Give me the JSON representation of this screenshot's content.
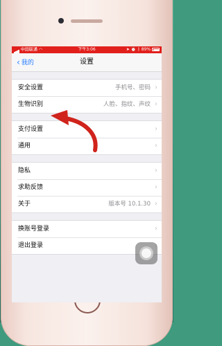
{
  "statusbar": {
    "carrier": "中国联通",
    "time": "下午3:06",
    "battery": "89%",
    "battery_level": 0.89
  },
  "navbar": {
    "back_label": "我的",
    "title": "设置"
  },
  "groups": [
    {
      "rows": [
        {
          "label": "安全设置",
          "value": "手机号、密码"
        },
        {
          "label": "生物识别",
          "value": "人脸、指纹、声纹"
        }
      ]
    },
    {
      "rows": [
        {
          "label": "支付设置",
          "value": ""
        },
        {
          "label": "通用",
          "value": ""
        }
      ]
    },
    {
      "rows": [
        {
          "label": "隐私",
          "value": ""
        },
        {
          "label": "求助反馈",
          "value": ""
        },
        {
          "label": "关于",
          "value": "版本号 10.1.30"
        }
      ]
    },
    {
      "rows": [
        {
          "label": "换账号登录",
          "value": ""
        },
        {
          "label": "退出登录",
          "value": ""
        }
      ]
    }
  ],
  "colors": {
    "statusbar": "#e1201c",
    "link": "#2a7fff",
    "annotation_arrow": "#d0231c"
  },
  "icons": [
    "chevron-right-icon",
    "chevron-left-icon",
    "wifi-icon",
    "battery-icon",
    "assistive-touch-icon"
  ]
}
